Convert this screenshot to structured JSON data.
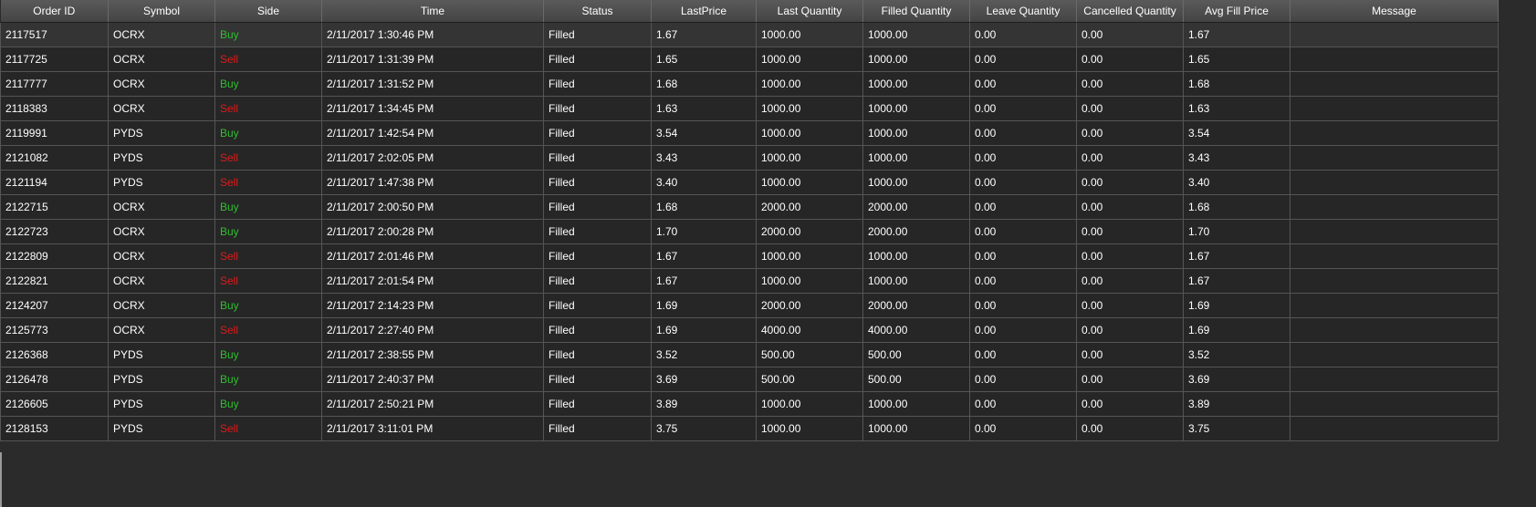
{
  "columns": [
    "Order ID",
    "Symbol",
    "Side",
    "Time",
    "Status",
    "LastPrice",
    "Last Quantity",
    "Filled Quantity",
    "Leave Quantity",
    "Cancelled Quantity",
    "Avg Fill Price",
    "Message"
  ],
  "rows": [
    {
      "order_id": "2117517",
      "symbol": "OCRX",
      "side": "Buy",
      "time": "2/11/2017 1:30:46 PM",
      "status": "Filled",
      "last_price": "1.67",
      "last_qty": "1000.00",
      "filled_qty": "1000.00",
      "leave_qty": "0.00",
      "cancelled_qty": "0.00",
      "avg_fill_price": "1.67",
      "message": ""
    },
    {
      "order_id": "2117725",
      "symbol": "OCRX",
      "side": "Sell",
      "time": "2/11/2017 1:31:39 PM",
      "status": "Filled",
      "last_price": "1.65",
      "last_qty": "1000.00",
      "filled_qty": "1000.00",
      "leave_qty": "0.00",
      "cancelled_qty": "0.00",
      "avg_fill_price": "1.65",
      "message": ""
    },
    {
      "order_id": "2117777",
      "symbol": "OCRX",
      "side": "Buy",
      "time": "2/11/2017 1:31:52 PM",
      "status": "Filled",
      "last_price": "1.68",
      "last_qty": "1000.00",
      "filled_qty": "1000.00",
      "leave_qty": "0.00",
      "cancelled_qty": "0.00",
      "avg_fill_price": "1.68",
      "message": ""
    },
    {
      "order_id": "2118383",
      "symbol": "OCRX",
      "side": "Sell",
      "time": "2/11/2017 1:34:45 PM",
      "status": "Filled",
      "last_price": "1.63",
      "last_qty": "1000.00",
      "filled_qty": "1000.00",
      "leave_qty": "0.00",
      "cancelled_qty": "0.00",
      "avg_fill_price": "1.63",
      "message": ""
    },
    {
      "order_id": "2119991",
      "symbol": "PYDS",
      "side": "Buy",
      "time": "2/11/2017 1:42:54 PM",
      "status": "Filled",
      "last_price": "3.54",
      "last_qty": "1000.00",
      "filled_qty": "1000.00",
      "leave_qty": "0.00",
      "cancelled_qty": "0.00",
      "avg_fill_price": "3.54",
      "message": ""
    },
    {
      "order_id": "2121082",
      "symbol": "PYDS",
      "side": "Sell",
      "time": "2/11/2017 2:02:05 PM",
      "status": "Filled",
      "last_price": "3.43",
      "last_qty": "1000.00",
      "filled_qty": "1000.00",
      "leave_qty": "0.00",
      "cancelled_qty": "0.00",
      "avg_fill_price": "3.43",
      "message": ""
    },
    {
      "order_id": "2121194",
      "symbol": "PYDS",
      "side": "Sell",
      "time": "2/11/2017 1:47:38 PM",
      "status": "Filled",
      "last_price": "3.40",
      "last_qty": "1000.00",
      "filled_qty": "1000.00",
      "leave_qty": "0.00",
      "cancelled_qty": "0.00",
      "avg_fill_price": "3.40",
      "message": ""
    },
    {
      "order_id": "2122715",
      "symbol": "OCRX",
      "side": "Buy",
      "time": "2/11/2017 2:00:50 PM",
      "status": "Filled",
      "last_price": "1.68",
      "last_qty": "2000.00",
      "filled_qty": "2000.00",
      "leave_qty": "0.00",
      "cancelled_qty": "0.00",
      "avg_fill_price": "1.68",
      "message": ""
    },
    {
      "order_id": "2122723",
      "symbol": "OCRX",
      "side": "Buy",
      "time": "2/11/2017 2:00:28 PM",
      "status": "Filled",
      "last_price": "1.70",
      "last_qty": "2000.00",
      "filled_qty": "2000.00",
      "leave_qty": "0.00",
      "cancelled_qty": "0.00",
      "avg_fill_price": "1.70",
      "message": ""
    },
    {
      "order_id": "2122809",
      "symbol": "OCRX",
      "side": "Sell",
      "time": "2/11/2017 2:01:46 PM",
      "status": "Filled",
      "last_price": "1.67",
      "last_qty": "1000.00",
      "filled_qty": "1000.00",
      "leave_qty": "0.00",
      "cancelled_qty": "0.00",
      "avg_fill_price": "1.67",
      "message": ""
    },
    {
      "order_id": "2122821",
      "symbol": "OCRX",
      "side": "Sell",
      "time": "2/11/2017 2:01:54 PM",
      "status": "Filled",
      "last_price": "1.67",
      "last_qty": "1000.00",
      "filled_qty": "1000.00",
      "leave_qty": "0.00",
      "cancelled_qty": "0.00",
      "avg_fill_price": "1.67",
      "message": ""
    },
    {
      "order_id": "2124207",
      "symbol": "OCRX",
      "side": "Buy",
      "time": "2/11/2017 2:14:23 PM",
      "status": "Filled",
      "last_price": "1.69",
      "last_qty": "2000.00",
      "filled_qty": "2000.00",
      "leave_qty": "0.00",
      "cancelled_qty": "0.00",
      "avg_fill_price": "1.69",
      "message": ""
    },
    {
      "order_id": "2125773",
      "symbol": "OCRX",
      "side": "Sell",
      "time": "2/11/2017 2:27:40 PM",
      "status": "Filled",
      "last_price": "1.69",
      "last_qty": "4000.00",
      "filled_qty": "4000.00",
      "leave_qty": "0.00",
      "cancelled_qty": "0.00",
      "avg_fill_price": "1.69",
      "message": ""
    },
    {
      "order_id": "2126368",
      "symbol": "PYDS",
      "side": "Buy",
      "time": "2/11/2017 2:38:55 PM",
      "status": "Filled",
      "last_price": "3.52",
      "last_qty": "500.00",
      "filled_qty": "500.00",
      "leave_qty": "0.00",
      "cancelled_qty": "0.00",
      "avg_fill_price": "3.52",
      "message": ""
    },
    {
      "order_id": "2126478",
      "symbol": "PYDS",
      "side": "Buy",
      "time": "2/11/2017 2:40:37 PM",
      "status": "Filled",
      "last_price": "3.69",
      "last_qty": "500.00",
      "filled_qty": "500.00",
      "leave_qty": "0.00",
      "cancelled_qty": "0.00",
      "avg_fill_price": "3.69",
      "message": ""
    },
    {
      "order_id": "2126605",
      "symbol": "PYDS",
      "side": "Buy",
      "time": "2/11/2017 2:50:21 PM",
      "status": "Filled",
      "last_price": "3.89",
      "last_qty": "1000.00",
      "filled_qty": "1000.00",
      "leave_qty": "0.00",
      "cancelled_qty": "0.00",
      "avg_fill_price": "3.89",
      "message": ""
    },
    {
      "order_id": "2128153",
      "symbol": "PYDS",
      "side": "Sell",
      "time": "2/11/2017 3:11:01 PM",
      "status": "Filled",
      "last_price": "3.75",
      "last_qty": "1000.00",
      "filled_qty": "1000.00",
      "leave_qty": "0.00",
      "cancelled_qty": "0.00",
      "avg_fill_price": "3.75",
      "message": ""
    }
  ],
  "colors": {
    "buy": "#2fbf2f",
    "sell": "#e01a1a",
    "background": "#2b2b2b",
    "cell_background": "#262626",
    "selected_row": "#343434"
  }
}
